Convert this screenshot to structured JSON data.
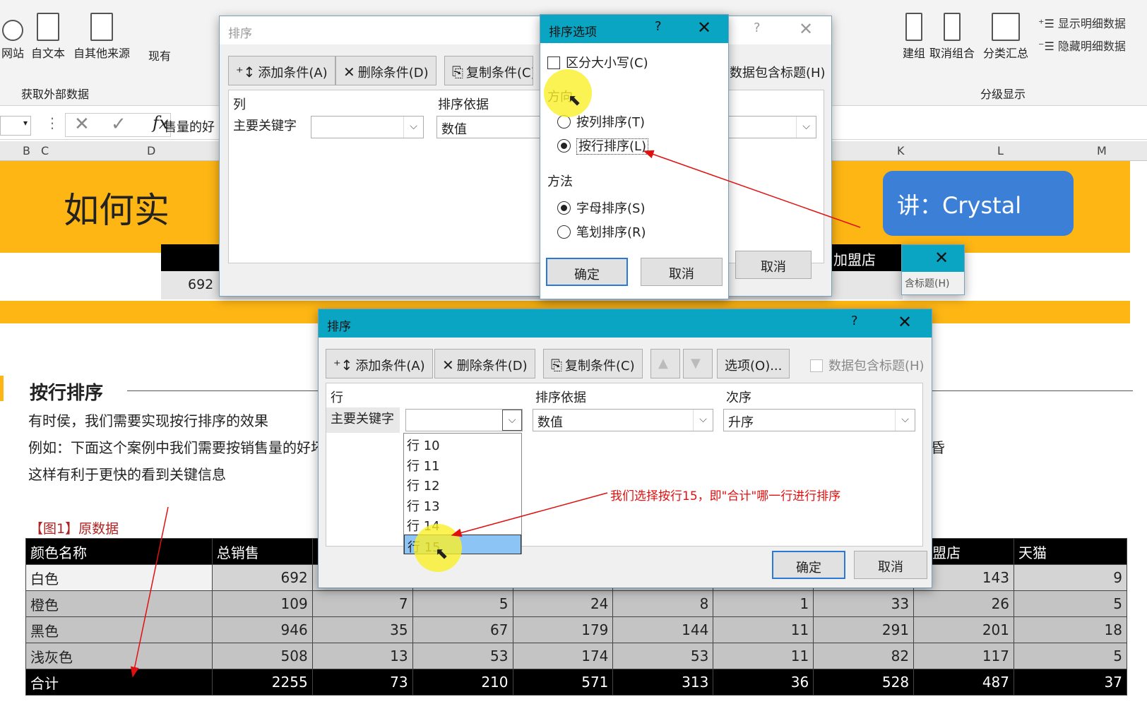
{
  "ribbon": {
    "buttons": [
      "网站",
      "自文本",
      "自其他来源",
      "现有"
    ],
    "external_group": "获取外部数据",
    "outline_buttons": [
      "建组",
      "取消组合",
      "分类汇总"
    ],
    "show_detail": "显示明细数据",
    "hide_detail": "隐藏明细数据",
    "outline_group": "分级显示"
  },
  "formula": {
    "fx": "fx",
    "value": "售量的好"
  },
  "columns": [
    "B",
    "C",
    "D",
    "K",
    "L",
    "M"
  ],
  "banner": {
    "title": "如何实",
    "lecturer": "讲：Crystal",
    "store": "加盟店",
    "cell_692": "692"
  },
  "doc": {
    "section_title": "按行排序",
    "p1": "有时侯，我们需要实现按行排序的效果",
    "p2": "例如：下面这个案例中我们需要按销售量的好坏",
    "p3": "这样有利于更快的看到关键信息",
    "fig": "【图1】原数据"
  },
  "table": {
    "headers": [
      "颜色名称",
      "总销售",
      "",
      "",
      "",
      "",
      "",
      "",
      "加盟店",
      "天猫"
    ],
    "rows": [
      {
        "name": "白色",
        "vals": [
          "692",
          "",
          "",
          "",
          "",
          "",
          "",
          "143",
          "9"
        ]
      },
      {
        "name": "橙色",
        "vals": [
          "109",
          "7",
          "5",
          "24",
          "8",
          "1",
          "33",
          "26",
          "5"
        ]
      },
      {
        "name": "黑色",
        "vals": [
          "946",
          "35",
          "67",
          "179",
          "144",
          "11",
          "291",
          "201",
          "18"
        ]
      },
      {
        "name": "浅灰色",
        "vals": [
          "508",
          "13",
          "53",
          "174",
          "53",
          "11",
          "82",
          "117",
          "5"
        ]
      },
      {
        "name": "合计",
        "vals": [
          "2255",
          "73",
          "210",
          "571",
          "313",
          "36",
          "528",
          "487",
          "37"
        ]
      }
    ]
  },
  "bg_dialog": {
    "title": "排序",
    "add": "添加条件(A)",
    "delete": "删除条件(D)",
    "copy": "复制条件(C)",
    "has_header": "数据包含标题(H)",
    "col_header": "列",
    "sort_on_header": "排序依据",
    "primary_key": "主要关键字",
    "sort_on_value": "数值",
    "cancel": "取消",
    "partial_title": "含标题(H)"
  },
  "options_dialog": {
    "title": "排序选项",
    "case_sensitive": "区分大小写(C)",
    "direction_label": "方向",
    "by_column": "按列排序(T)",
    "by_row": "按行排序(L)",
    "method_label": "方法",
    "alpha": "字母排序(S)",
    "stroke": "笔划排序(R)",
    "ok": "确定",
    "cancel": "取消"
  },
  "main_dialog": {
    "title": "排序",
    "add": "添加条件(A)",
    "delete": "删除条件(D)",
    "copy": "复制条件(C)",
    "options": "选项(O)...",
    "has_header": "数据包含标题(H)",
    "row_header": "行",
    "sort_on_header": "排序依据",
    "order_header": "次序",
    "primary_key": "主要关键字",
    "sort_on_value": "数值",
    "order_value": "升序",
    "ok": "确定",
    "cancel": "取消"
  },
  "dropdown": [
    "行 10",
    "行 11",
    "行 12",
    "行 13",
    "行 14",
    "行 15"
  ],
  "annotation": "我们选择按行15，即\"合计\"哪一行进行排序",
  "colors": {
    "accent": "#0aa5c3",
    "banner": "#fdb614",
    "annotation": "#e01010",
    "selection": "#8bc4f5"
  }
}
